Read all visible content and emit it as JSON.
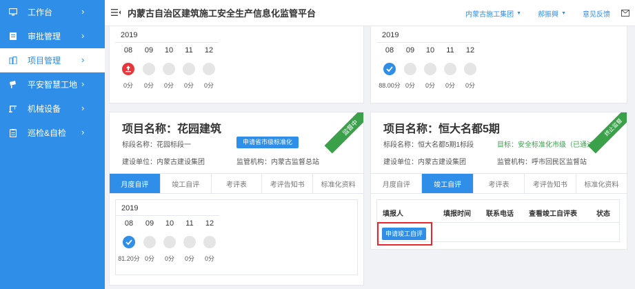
{
  "sidebar": {
    "items": [
      {
        "label": "工作台",
        "icon": "monitor-icon",
        "active": false
      },
      {
        "label": "审批管理",
        "icon": "document-icon",
        "active": false
      },
      {
        "label": "项目管理",
        "icon": "building-icon",
        "active": true
      },
      {
        "label": "平安智慧工地",
        "icon": "camera-icon",
        "active": false
      },
      {
        "label": "机械设备",
        "icon": "crane-icon",
        "active": false
      },
      {
        "label": "巡检&自检",
        "icon": "clipboard-icon",
        "active": false
      }
    ]
  },
  "header": {
    "title": "内蒙古自治区建筑施工安全生产信息化监管平台",
    "org": "内蒙古施工集团",
    "user": "郝振興",
    "feedback": "意见反馈"
  },
  "top_left_timeline": {
    "year": "2019",
    "months": [
      "08",
      "09",
      "10",
      "11",
      "12"
    ],
    "scores": [
      "0分",
      "0分",
      "0分",
      "0分",
      "0分"
    ]
  },
  "top_right_timeline": {
    "year": "2019",
    "months": [
      "08",
      "09",
      "10",
      "11",
      "12"
    ],
    "scores": [
      "88.00分",
      "0分",
      "0分",
      "0分",
      "0分"
    ]
  },
  "project_left": {
    "title": "项目名称：花园建筑",
    "section": "标段名称：花园标段一",
    "builder": "建设单位：内蒙古建设集团",
    "supervisor": "监管机构：内蒙古监督总站",
    "apply_button": "申请省市级标准化",
    "ribbon": "监督中",
    "tabs": [
      "月度自评",
      "竣工自评",
      "考评表",
      "考评告知书",
      "标准化资料"
    ],
    "active_tab": 0,
    "timeline": {
      "year": "2019",
      "months": [
        "08",
        "09",
        "10",
        "11",
        "12"
      ],
      "scores": [
        "81.20分",
        "0分",
        "0分",
        "0分",
        "0分"
      ]
    }
  },
  "project_right": {
    "title": "项目名称：恒大名都5期",
    "section": "标段名称：恒大名都5期1标段",
    "goal": "目标：安全标准化市级（已通过）",
    "builder": "建设单位：内蒙古建设集团",
    "supervisor": "监管机构：呼市回民区监督站",
    "ribbon": "终止监督",
    "tabs": [
      "月度自评",
      "竣工自评",
      "考评表",
      "考评告知书",
      "标准化资料"
    ],
    "active_tab": 1,
    "table_headers": [
      "填报人",
      "填报时间",
      "联系电话",
      "查看竣工自评表",
      "状态"
    ],
    "apply_button": "申请竣工自评"
  },
  "colors": {
    "primary": "#2f8ee8",
    "alert": "#e8363b",
    "ribbon": "#3aa14a",
    "highlight": "#e8262b"
  }
}
